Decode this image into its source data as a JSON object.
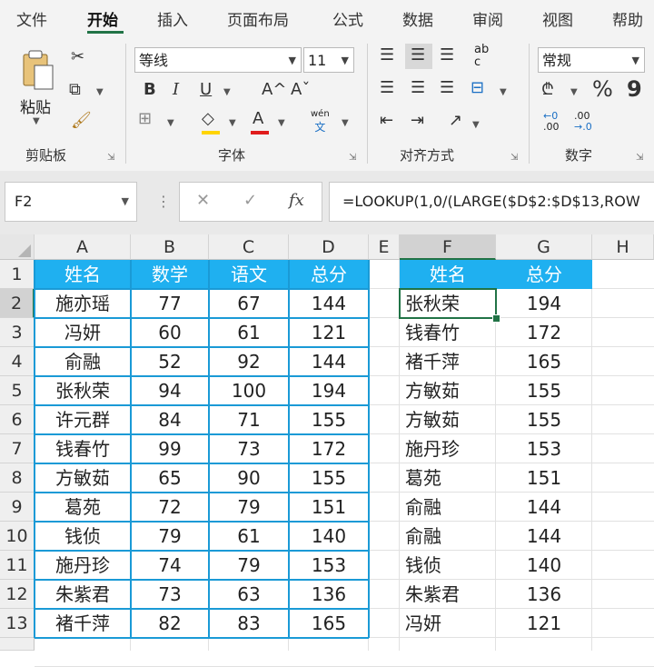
{
  "ribbon_tabs": [
    "文件",
    "开始",
    "插入",
    "页面布局",
    "公式",
    "数据",
    "审阅",
    "视图",
    "帮助"
  ],
  "clipboard": {
    "paste_label": "粘贴",
    "group_label": "剪贴板"
  },
  "font": {
    "name": "等线",
    "size": "11",
    "bold": "B",
    "italic": "I",
    "underline": "U",
    "grow": "A^",
    "shrink": "Aˇ",
    "font_color": "A",
    "phonetic_top": "wén",
    "phonetic_bottom": "文",
    "group_label": "字体"
  },
  "alignment": {
    "group_label": "对齐方式",
    "wrap_top": "ab",
    "wrap_bottom": "c"
  },
  "number": {
    "format": "常规",
    "percent": "%",
    "comma": "9",
    "inc_top": "←0",
    "inc_bottom": ".00",
    "dec_top": ".00",
    "dec_bottom": "→.0",
    "group_label": "数字"
  },
  "formula_bar": {
    "name_box": "F2",
    "cancel": "✕",
    "enter": "✓",
    "fx": "fx",
    "formula": "=LOOKUP(1,0/(LARGE($D$2:$D$13,ROW"
  },
  "columns": [
    "A",
    "B",
    "C",
    "D",
    "E",
    "F",
    "G",
    "H"
  ],
  "rows": [
    "1",
    "2",
    "3",
    "4",
    "5",
    "6",
    "7",
    "8",
    "9",
    "10",
    "11",
    "12",
    "13"
  ],
  "table1": {
    "headers": [
      "姓名",
      "数学",
      "语文",
      "总分"
    ],
    "rows": [
      [
        "施亦瑶",
        "77",
        "67",
        "144"
      ],
      [
        "冯妍",
        "60",
        "61",
        "121"
      ],
      [
        "俞融",
        "52",
        "92",
        "144"
      ],
      [
        "张秋荣",
        "94",
        "100",
        "194"
      ],
      [
        "许元群",
        "84",
        "71",
        "155"
      ],
      [
        "钱春竹",
        "99",
        "73",
        "172"
      ],
      [
        "方敏茹",
        "65",
        "90",
        "155"
      ],
      [
        "葛苑",
        "72",
        "79",
        "151"
      ],
      [
        "钱侦",
        "79",
        "61",
        "140"
      ],
      [
        "施丹珍",
        "74",
        "79",
        "153"
      ],
      [
        "朱紫君",
        "73",
        "63",
        "136"
      ],
      [
        "褚千萍",
        "82",
        "83",
        "165"
      ]
    ]
  },
  "table2": {
    "headers": [
      "姓名",
      "总分"
    ],
    "rows": [
      [
        "张秋荣",
        "194"
      ],
      [
        "钱春竹",
        "172"
      ],
      [
        "褚千萍",
        "165"
      ],
      [
        "方敏茹",
        "155"
      ],
      [
        "方敏茹",
        "155"
      ],
      [
        "施丹珍",
        "153"
      ],
      [
        "葛苑",
        "151"
      ],
      [
        "俞融",
        "144"
      ],
      [
        "俞融",
        "144"
      ],
      [
        "钱侦",
        "140"
      ],
      [
        "朱紫君",
        "136"
      ],
      [
        "冯妍",
        "121"
      ]
    ]
  },
  "colors": {
    "header_fill": "#1fb0f0",
    "selection": "#217346",
    "table_border": "#1a9ad6"
  }
}
